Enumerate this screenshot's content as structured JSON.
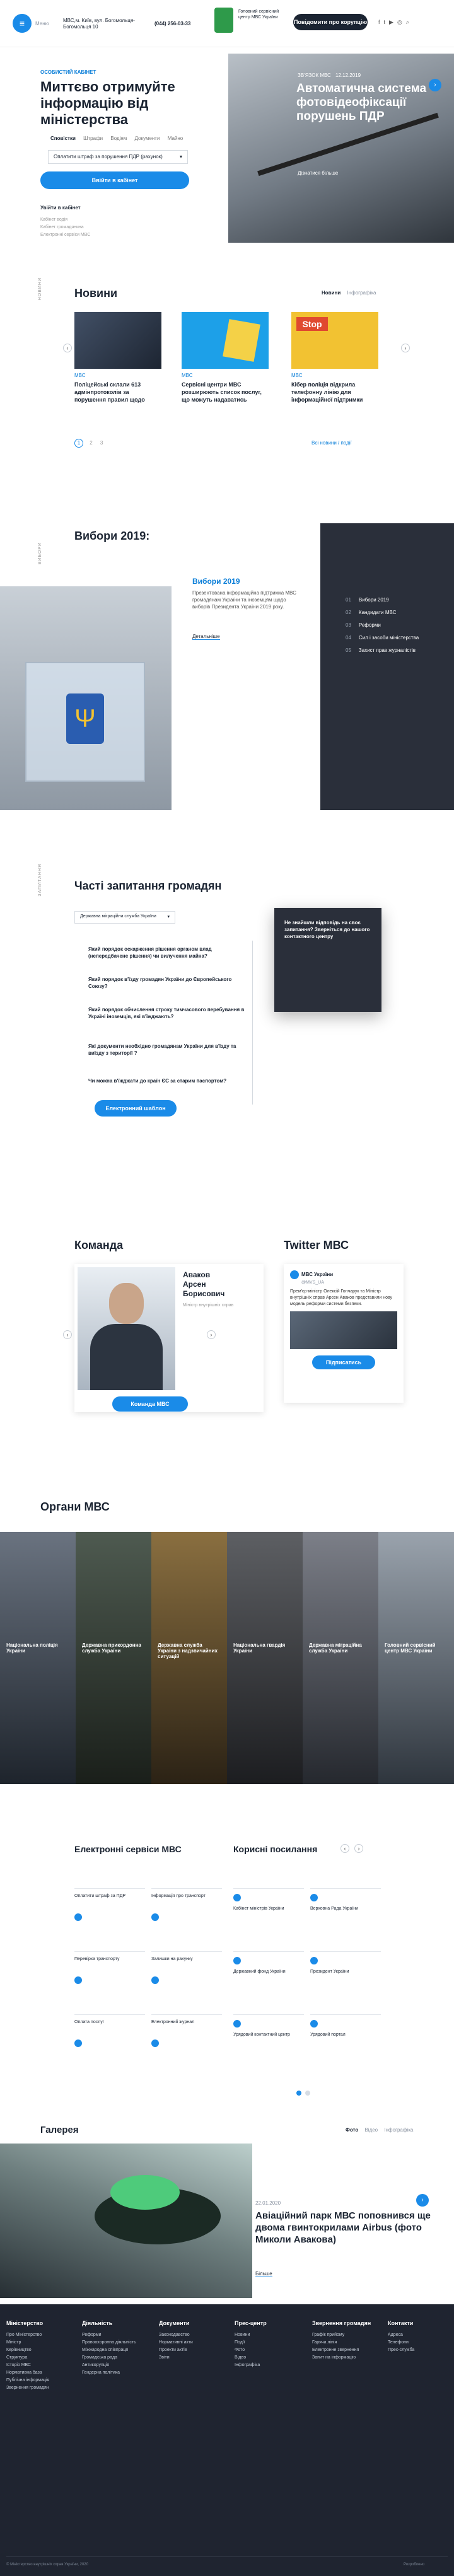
{
  "header": {
    "menu_label": "Меню",
    "address": "МВС,м. Київ, вул. Богомольця-Богомольця 10",
    "phone": "(044) 256-03-33",
    "ministry_name": "Головний сервісний центр МВС України",
    "report_button": "Повідомити про корупцію"
  },
  "hero": {
    "tag": "ОСОБИСТИЙ КАБІНЕТ",
    "title": "Миттєво отримуйте інформацію від міністерства",
    "tabs": [
      "Сповістки",
      "Штрафи",
      "Водіям",
      "Документи",
      "Майно"
    ],
    "select_value": "Оплатити штраф за порушення ПДР (рахунок)",
    "primary_button": "Ввійти в кабінет",
    "secondary_link": "Увійти в кабінет",
    "small_links": [
      "Кабінет водія",
      "Кабінет громадянина",
      "Електронні сервіси МВС"
    ],
    "side_tag": "ЗВ'ЯЗОК МВС",
    "side_date": "12.12.2019",
    "side_title": "Автоматична система фотовідеофіксації порушень ПДР",
    "side_more": "Дізнатися більше"
  },
  "news": {
    "title": "Новини",
    "filters": [
      "Новини",
      "Інфографіка"
    ],
    "items": [
      {
        "tag": "МВС",
        "date": "",
        "title": "Поліцейські склали 613 адмінпротоколів за порушення правил щодо"
      },
      {
        "tag": "МВС",
        "date": "",
        "title": "Сервісні центри МВС розширюють список послуг, що можуть надаватись"
      },
      {
        "tag": "МВС",
        "date": "",
        "title": "Кібер поліція відкрила телефонну лінію для інформаційної підтримки"
      }
    ],
    "more": "Всі новини / події",
    "vertical": "НОВИНИ"
  },
  "elections": {
    "title": "Вибори 2019:",
    "sub_title": "Вибори 2019",
    "text": "Презентована інформаційна підтримка МВС громадянам України та іноземцям щодо виборів Президента України 2019 року.",
    "link": "Детальніше",
    "vertical": "ВИБОРИ",
    "side_items": [
      {
        "num": "01",
        "label": "Вибори 2019"
      },
      {
        "num": "02",
        "label": "Кандидати МВС"
      },
      {
        "num": "03",
        "label": "Реформи"
      },
      {
        "num": "04",
        "label": "Сил і засоби міністерства"
      },
      {
        "num": "05",
        "label": "Захист прав журналістів"
      }
    ]
  },
  "faq": {
    "title": "Часті запитання громадян",
    "select_value": "Державна міграційна служба України",
    "questions": [
      "Який порядок оскарження рішення органом влад (непередбачене рішення) чи вилучення майна?",
      "Який порядок в'їзду громадян України до Європейського Союзу?",
      "Який порядок обчислення строку тимчасового перебування в Україні іноземців, які в'їжджають?",
      "Які документи необхідно громадянам України для в'їзду та виїзду з території ?",
      "Чи можна в'їжджати до країн ЄС за старим паспортом?"
    ],
    "button": "Електронний шаблон",
    "help_card": "Не знайшли відповідь на своє запитання? Зверніться до нашого контактного центру",
    "vertical": "ЗАПИТАННЯ"
  },
  "team": {
    "title": "Команда",
    "person_name": "Аваков Арсен Борисович",
    "person_role": "Міністр внутрішніх справ",
    "button": "Команда МВС"
  },
  "twitter": {
    "title": "Twitter МВС",
    "account": "МВС України",
    "handle": "@MVS_UA",
    "tweet": "Прем'єр-міністр Олексій Гончарук та Міністр внутрішніх справ Арсен Аваков представили нову модель реформи системи безпеки.",
    "button": "Підписатись"
  },
  "organs": {
    "title": "Органи МВС",
    "items": [
      "Національна поліція України",
      "Державна прикордонна служба України",
      "Державна служба України з надзвичайних ситуацій",
      "Національна гвардія України",
      "Державна міграційна служба України",
      "Головний сервісний центр МВС України"
    ]
  },
  "services": {
    "title": "Електронні сервіси МВС",
    "items": [
      "Оплатити штраф за ПДР",
      "Інформація про транспорт",
      "Перевірка транспорту",
      "Залишки на рахунку",
      "Оплата послуг",
      "Електронний журнал"
    ]
  },
  "useful": {
    "title": "Корисні посилання",
    "items": [
      "Кабінет міністрів України",
      "Верховна Рада України",
      "Державний фонд України",
      "Президент України",
      "Урядовий контактний центр",
      "Урядовий портал"
    ]
  },
  "gallery": {
    "title": "Галерея",
    "tabs": [
      "Фото",
      "Відео",
      "Інфографіка"
    ],
    "date": "22.01.2020",
    "caption": "Авіаційний парк МВС поповнився ще двома гвинтокрилами Airbus (фото Миколи Аваковa)",
    "more": "Більше"
  },
  "footer": {
    "columns": [
      {
        "title": "Міністерство",
        "items": [
          "Про Міністерство",
          "Міністр",
          "Керівництво",
          "Структура",
          "Історія МВС",
          "Нормативна база",
          "Публічна інформація",
          "Звернення громадян"
        ]
      },
      {
        "title": "Діяльність",
        "items": [
          "Реформи",
          "Правоохоронна діяльність",
          "Міжнародна співпраця",
          "Громадська рада",
          "Антикорупція",
          "Гендерна політика"
        ]
      },
      {
        "title": "Документи",
        "items": [
          "Законодавство",
          "Нормативні акти",
          "Проекти актів",
          "Звіти"
        ]
      },
      {
        "title": "Прес-центр",
        "items": [
          "Новини",
          "Події",
          "Фото",
          "Відео",
          "Інфографіка"
        ]
      },
      {
        "title": "Звернення громадян",
        "items": [
          "Графік прийому",
          "Гаряча лінія",
          "Електронне звернення",
          "Запит на інформацію"
        ]
      },
      {
        "title": "Контакти",
        "items": [
          "Адреса",
          "Телефони",
          "Прес-служба"
        ]
      }
    ],
    "copyright": "© Міністерство внутрішніх справ України, 2020",
    "developer": "Розроблено"
  }
}
